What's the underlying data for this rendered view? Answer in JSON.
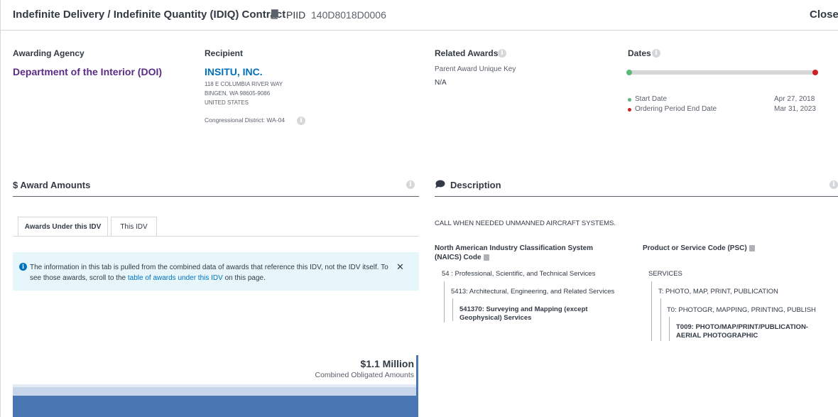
{
  "header": {
    "title": "Indefinite Delivery / Indefinite Quantity (IDIQ) Contract",
    "piid_label": "PIID",
    "piid_value": "140D8018D0006",
    "status": "Closed",
    "icons": [
      "book-icon"
    ]
  },
  "agency": {
    "label": "Awarding Agency",
    "name": "Department of the Interior (DOI)"
  },
  "recipient": {
    "label": "Recipient",
    "name": "INSITU, INC.",
    "address_line1": "118 E COLUMBIA RIVER WAY",
    "address_line2": "BINGEN, WA 98605-9086",
    "address_line3": "UNITED STATES",
    "congressional_district": "Congressional District: WA-04"
  },
  "related_awards": {
    "label": "Related Awards",
    "parent_key_label": "Parent Award Unique Key",
    "parent_key_value": "N/A"
  },
  "dates": {
    "label": "Dates",
    "start_label": "Start Date",
    "start_value": "Apr 27, 2018",
    "end_label": "Ordering Period End Date",
    "end_value": "Mar 31, 2023",
    "start_color": "#5eb77b",
    "end_color": "#cd2026"
  },
  "award_amounts": {
    "title": "$ Award Amounts",
    "tabs": [
      {
        "label": "Awards Under this IDV",
        "active": true
      },
      {
        "label": "This IDV",
        "active": false
      }
    ],
    "banner": {
      "text_before": "The information in this tab is pulled from the combined data of awards that reference this IDV, not the IDV itself. To see those awards, scroll to the ",
      "link": "table of awards under this IDV",
      "text_after": " on this page.",
      "close": "✕"
    },
    "amount": "$1.1 Million",
    "amount_label": "Combined Obligated Amounts"
  },
  "description": {
    "title": "Description",
    "text": "CALL WHEN NEEDED UNMANNED AIRCRAFT SYSTEMS.",
    "naics": {
      "heading": "North American Industry Classification System (NAICS) Code",
      "level1": "54 : Professional, Scientific, and Technical Services",
      "level2": "5413: Architectural, Engineering, and Related Services",
      "level3": "541370: Surveying and Mapping (except Geophysical) Services"
    },
    "psc": {
      "heading": "Product or Service Code (PSC)",
      "level1": "SERVICES",
      "level2": "T: PHOTO, MAP, PRINT, PUBLICATION",
      "level3": "T0: PHOTOGR, MAPPING, PRINTING, PUBLISH",
      "level4": "T009: PHOTO/MAP/PRINT/PUBLICATION-AERIAL PHOTOGRAPHIC"
    }
  },
  "colors": {
    "agency": "#5b2c86",
    "link": "#0071bc",
    "chart_bar": "#4a77b4",
    "banner_bg": "#e7f6fa"
  }
}
